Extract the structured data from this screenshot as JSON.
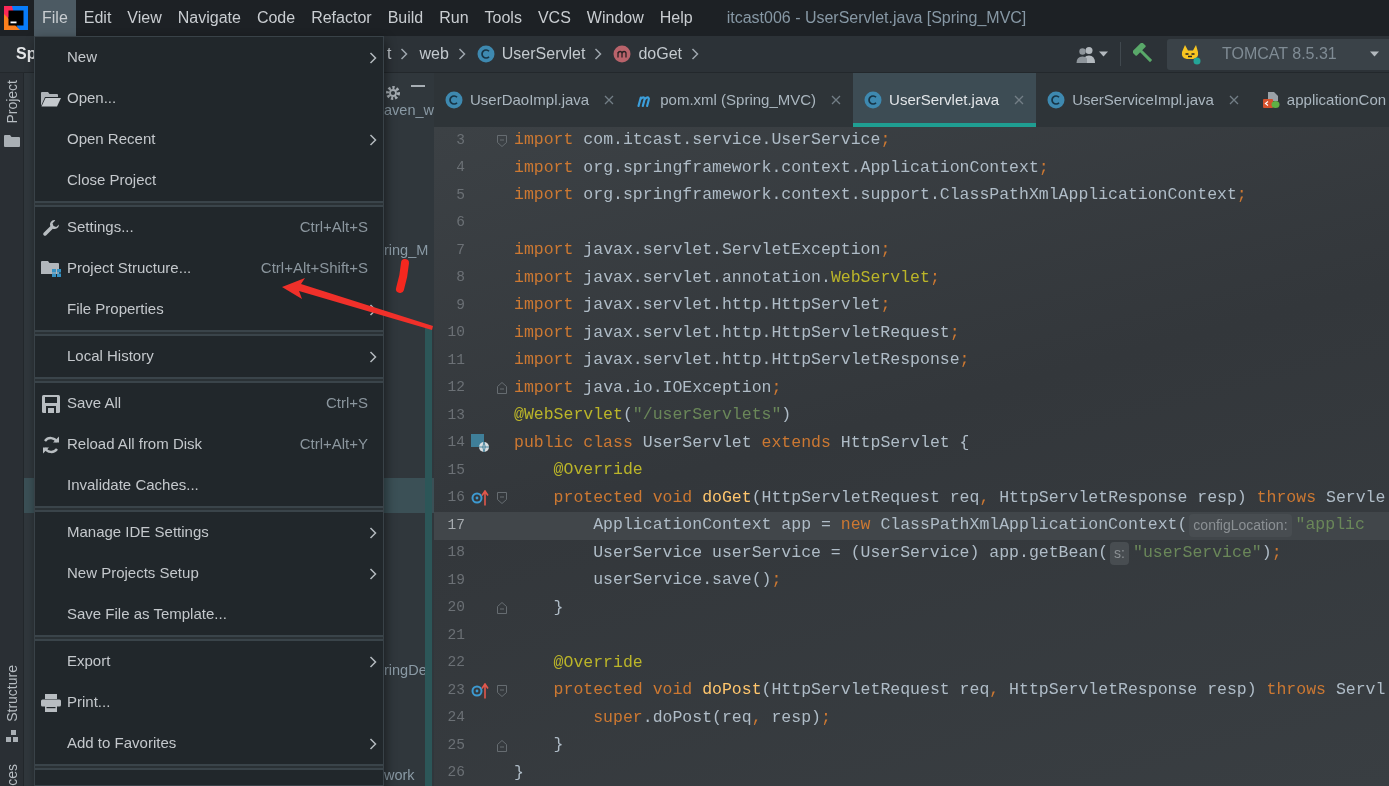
{
  "menu_bar": {
    "items": [
      {
        "label": "File",
        "selected": true
      },
      {
        "label": "Edit",
        "selected": false
      },
      {
        "label": "View",
        "selected": false
      },
      {
        "label": "Navigate",
        "selected": false
      },
      {
        "label": "Code",
        "selected": false
      },
      {
        "label": "Refactor",
        "selected": false
      },
      {
        "label": "Build",
        "selected": false
      },
      {
        "label": "Run",
        "selected": false
      },
      {
        "label": "Tools",
        "selected": false
      },
      {
        "label": "VCS",
        "selected": false
      },
      {
        "label": "Window",
        "selected": false
      },
      {
        "label": "Help",
        "selected": false
      }
    ]
  },
  "file_menu": {
    "groups": [
      {
        "items": [
          {
            "label": "New",
            "submenu": true
          },
          {
            "label": "Open...",
            "submenu": false
          },
          {
            "label": "Open Recent",
            "submenu": true
          },
          {
            "label": "Close Project",
            "submenu": false
          }
        ]
      },
      {
        "items": [
          {
            "label": "Settings...",
            "shortcut": "Ctrl+Alt+S",
            "submenu": false
          },
          {
            "label": "Project Structure...",
            "shortcut": "Ctrl+Alt+Shift+S",
            "submenu": false
          },
          {
            "label": "File Properties",
            "submenu": true
          }
        ]
      },
      {
        "items": [
          {
            "label": "Local History",
            "submenu": true
          }
        ]
      },
      {
        "items": [
          {
            "label": "Save All",
            "shortcut": "Ctrl+S",
            "submenu": false
          },
          {
            "label": "Reload All from Disk",
            "shortcut": "Ctrl+Alt+Y",
            "submenu": false
          },
          {
            "label": "Invalidate Caches...",
            "submenu": false
          }
        ]
      },
      {
        "items": [
          {
            "label": "Manage IDE Settings",
            "submenu": true
          },
          {
            "label": "New Projects Setup",
            "submenu": true
          },
          {
            "label": "Save File as Template...",
            "submenu": false
          }
        ]
      },
      {
        "items": [
          {
            "label": "Export",
            "submenu": true
          },
          {
            "label": "Print...",
            "submenu": false
          },
          {
            "label": "Add to Favorites",
            "submenu": true
          }
        ]
      }
    ]
  },
  "window_title": "itcast006 - UserServlet.java [Spring_MVC]",
  "navigation_bar": {
    "project": "Sp",
    "breadcrumbs": [
      {
        "label": "t",
        "kind": "folder"
      },
      {
        "label": "web",
        "kind": "folder"
      },
      {
        "label": "UserServlet",
        "kind": "class"
      },
      {
        "label": "doGet",
        "kind": "method"
      }
    ],
    "run_configuration": "TOMCAT 8.5.31"
  },
  "tool_window_bar": {
    "top": [
      {
        "label": "Project"
      }
    ],
    "bottom": [
      {
        "label": "Structure"
      },
      {
        "label": "ces"
      }
    ]
  },
  "project_panel": {
    "rows": [
      {
        "text": "aven_w",
        "selected": false
      },
      {
        "text": "ring_M",
        "selected": false
      },
      {
        "selected": true
      },
      {
        "text": "ringDe",
        "selected": false
      },
      {
        "text": "work",
        "selected": false
      }
    ]
  },
  "editor": {
    "tabs": [
      {
        "label": "UserDaoImpl.java",
        "kind": "class",
        "selected": false,
        "closable": true
      },
      {
        "label": "pom.xml (Spring_MVC)",
        "kind": "maven",
        "selected": false,
        "closable": true
      },
      {
        "label": "UserServlet.java",
        "kind": "class",
        "selected": true,
        "closable": true
      },
      {
        "label": "UserServiceImpl.java",
        "kind": "class",
        "selected": false,
        "closable": true
      },
      {
        "label": "applicationCon",
        "kind": "xml",
        "selected": false,
        "closable": false
      }
    ],
    "lines": [
      {
        "number": "3",
        "current": false,
        "fold": {
          "kind": "start"
        },
        "tokens": [
          {
            "kind": "keyword",
            "text": "import"
          },
          {
            "kind": "plain",
            "text": " com.itcast.service.UserService"
          },
          {
            "kind": "punct",
            "text": ";"
          }
        ]
      },
      {
        "number": "4",
        "current": false,
        "tokens": [
          {
            "kind": "keyword",
            "text": "import"
          },
          {
            "kind": "plain",
            "text": " org.springframework.context.ApplicationContext"
          },
          {
            "kind": "punct",
            "text": ";"
          }
        ]
      },
      {
        "number": "5",
        "current": false,
        "tokens": [
          {
            "kind": "keyword",
            "text": "import"
          },
          {
            "kind": "plain",
            "text": " org.springframework.context.support.ClassPathXmlApplicationContext"
          },
          {
            "kind": "punct",
            "text": ";"
          }
        ]
      },
      {
        "number": "6",
        "current": false
      },
      {
        "number": "7",
        "current": false,
        "tokens": [
          {
            "kind": "keyword",
            "text": "import"
          },
          {
            "kind": "plain",
            "text": " javax.servlet.ServletException"
          },
          {
            "kind": "punct",
            "text": ";"
          }
        ]
      },
      {
        "number": "8",
        "current": false,
        "tokens": [
          {
            "kind": "keyword",
            "text": "import"
          },
          {
            "kind": "plain",
            "text": " javax.servlet.annotation."
          },
          {
            "kind": "annotation",
            "text": "WebServlet"
          },
          {
            "kind": "punct",
            "text": ";"
          }
        ]
      },
      {
        "number": "9",
        "current": false,
        "tokens": [
          {
            "kind": "keyword",
            "text": "import"
          },
          {
            "kind": "plain",
            "text": " javax.servlet.http.HttpServlet"
          },
          {
            "kind": "punct",
            "text": ";"
          }
        ]
      },
      {
        "number": "10",
        "current": false,
        "tokens": [
          {
            "kind": "keyword",
            "text": "import"
          },
          {
            "kind": "plain",
            "text": " javax.servlet.http.HttpServletRequest"
          },
          {
            "kind": "punct",
            "text": ";"
          }
        ]
      },
      {
        "number": "11",
        "current": false,
        "tokens": [
          {
            "kind": "keyword",
            "text": "import"
          },
          {
            "kind": "plain",
            "text": " javax.servlet.http.HttpServletResponse"
          },
          {
            "kind": "punct",
            "text": ";"
          }
        ]
      },
      {
        "number": "12",
        "current": false,
        "fold": {
          "kind": "end"
        },
        "tokens": [
          {
            "kind": "keyword",
            "text": "import"
          },
          {
            "kind": "plain",
            "text": " java.io.IOException"
          },
          {
            "kind": "punct",
            "text": ";"
          }
        ]
      },
      {
        "number": "13",
        "current": false,
        "tokens": [
          {
            "kind": "annotation",
            "text": "@WebServlet"
          },
          {
            "kind": "plain",
            "text": "("
          },
          {
            "kind": "string",
            "text": "\"/userServlets\""
          },
          {
            "kind": "plain",
            "text": ")"
          }
        ]
      },
      {
        "number": "14",
        "current": false,
        "marker": {
          "kind": "web_class"
        },
        "tokens": [
          {
            "kind": "keyword",
            "text": "public class"
          },
          {
            "kind": "plain",
            "text": " UserServlet "
          },
          {
            "kind": "keyword",
            "text": "extends"
          },
          {
            "kind": "plain",
            "text": " HttpServlet {"
          }
        ]
      },
      {
        "number": "15",
        "current": false,
        "tokens": [
          {
            "kind": "annotation",
            "text": "    @Override"
          }
        ]
      },
      {
        "number": "16",
        "current": false,
        "marker": {
          "kind": "override"
        },
        "fold": {
          "kind": "start"
        },
        "tokens": [
          {
            "kind": "keyword",
            "text": "    protected void "
          },
          {
            "kind": "method",
            "text": "doGet"
          },
          {
            "kind": "plain",
            "text": "(HttpServletRequest req"
          },
          {
            "kind": "punct",
            "text": ","
          },
          {
            "kind": "plain",
            "text": " HttpServletResponse resp) "
          },
          {
            "kind": "keyword",
            "text": "throws"
          },
          {
            "kind": "plain",
            "text": " Servle"
          }
        ]
      },
      {
        "number": "17",
        "current": true,
        "tokens": [
          {
            "kind": "plain",
            "text": "        ApplicationContext app = "
          },
          {
            "kind": "keyword",
            "text": "new"
          },
          {
            "kind": "plain",
            "text": " ClassPathXmlApplicationContext("
          },
          {
            "kind": "hint",
            "text": "configLocation:"
          },
          {
            "kind": "string",
            "text": "\"applic"
          }
        ]
      },
      {
        "number": "18",
        "current": false,
        "tokens": [
          {
            "kind": "plain",
            "text": "        UserService userService = (UserService) app.getBean("
          },
          {
            "kind": "hint",
            "text": "s:"
          },
          {
            "kind": "string",
            "text": "\"userService\""
          },
          {
            "kind": "plain",
            "text": ")"
          },
          {
            "kind": "punct",
            "text": ";"
          }
        ]
      },
      {
        "number": "19",
        "current": false,
        "tokens": [
          {
            "kind": "plain",
            "text": "        userService.save()"
          },
          {
            "kind": "punct",
            "text": ";"
          }
        ]
      },
      {
        "number": "20",
        "current": false,
        "fold": {
          "kind": "end"
        },
        "tokens": [
          {
            "kind": "plain",
            "text": "    }"
          }
        ]
      },
      {
        "number": "21",
        "current": false
      },
      {
        "number": "22",
        "current": false,
        "tokens": [
          {
            "kind": "annotation",
            "text": "    @Override"
          }
        ]
      },
      {
        "number": "23",
        "current": false,
        "marker": {
          "kind": "override"
        },
        "fold": {
          "kind": "start"
        },
        "tokens": [
          {
            "kind": "keyword",
            "text": "    protected void "
          },
          {
            "kind": "method",
            "text": "doPost"
          },
          {
            "kind": "plain",
            "text": "(HttpServletRequest req"
          },
          {
            "kind": "punct",
            "text": ","
          },
          {
            "kind": "plain",
            "text": " HttpServletResponse resp) "
          },
          {
            "kind": "keyword",
            "text": "throws"
          },
          {
            "kind": "plain",
            "text": " Servl"
          }
        ]
      },
      {
        "number": "24",
        "current": false,
        "tokens": [
          {
            "kind": "keyword",
            "text": "        super"
          },
          {
            "kind": "plain",
            "text": ".doPost(req"
          },
          {
            "kind": "punct",
            "text": ","
          },
          {
            "kind": "plain",
            "text": " resp)"
          },
          {
            "kind": "punct",
            "text": ";"
          }
        ]
      },
      {
        "number": "25",
        "current": false,
        "fold": {
          "kind": "end"
        },
        "tokens": [
          {
            "kind": "plain",
            "text": "    }"
          }
        ]
      },
      {
        "number": "26",
        "current": false,
        "tokens": [
          {
            "kind": "plain",
            "text": "}"
          }
        ]
      }
    ]
  }
}
